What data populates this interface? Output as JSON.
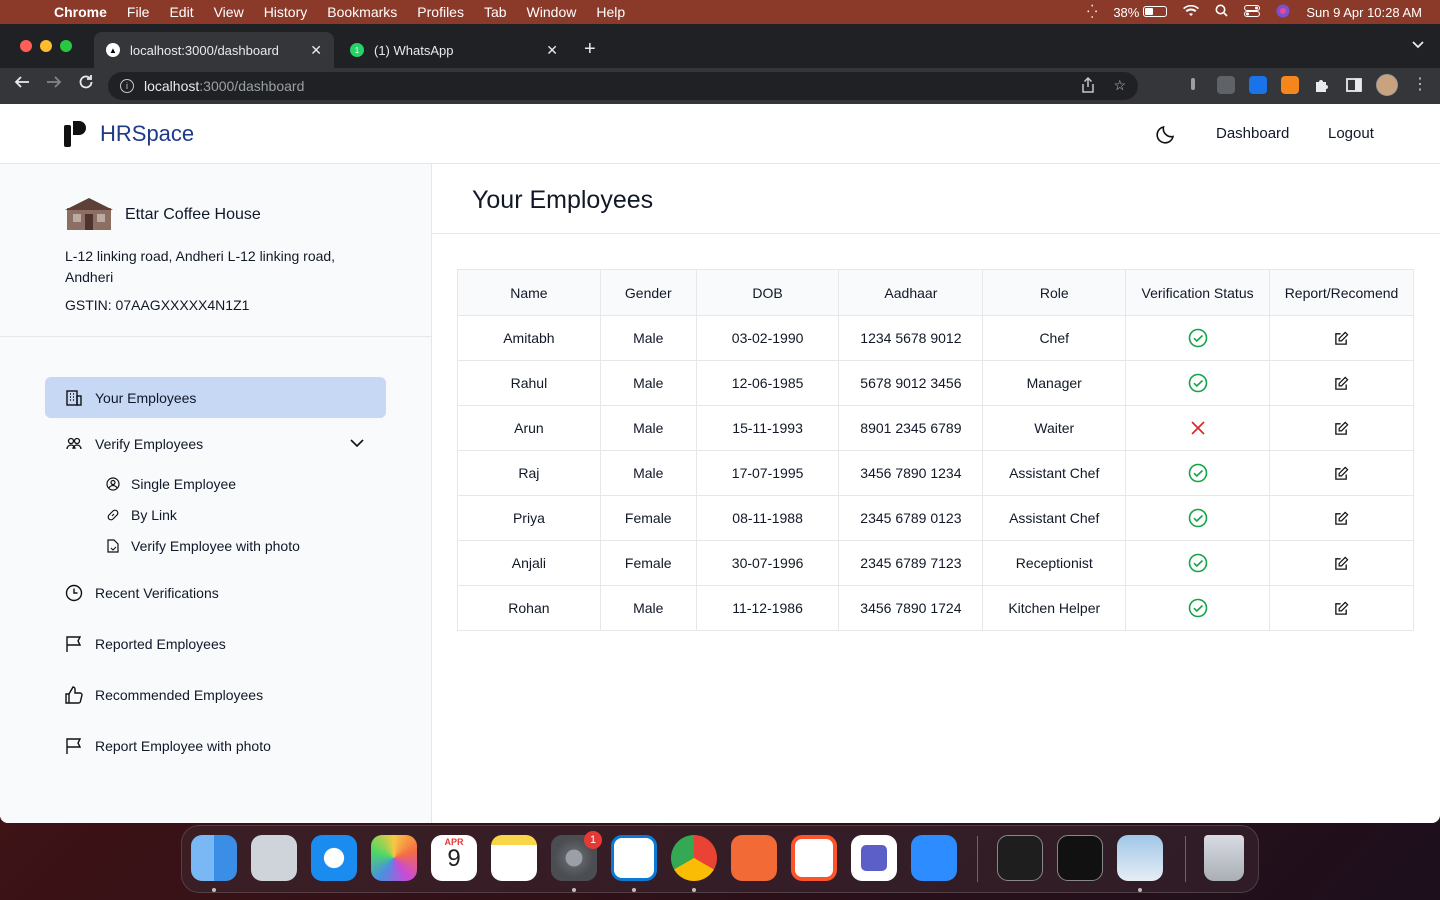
{
  "menubar": {
    "app": "Chrome",
    "items": [
      "File",
      "Edit",
      "View",
      "History",
      "Bookmarks",
      "Profiles",
      "Tab",
      "Window",
      "Help"
    ],
    "battery": "38%",
    "datetime": "Sun 9 Apr  10:28 AM"
  },
  "browser": {
    "tabs": [
      {
        "title": "localhost:3000/dashboard",
        "active": true
      },
      {
        "title": "(1) WhatsApp",
        "active": false
      }
    ],
    "url_host": "localhost",
    "url_path": ":3000/dashboard"
  },
  "app": {
    "brand": "HRSpace",
    "nav": {
      "dashboard": "Dashboard",
      "logout": "Logout"
    },
    "business": {
      "name": "Ettar Coffee House",
      "address": "L-12 linking road, Andheri L-12 linking road, Andheri",
      "gstin": "GSTIN: 07AAGXXXXX4N1Z1"
    },
    "sidebar": {
      "your_employees": "Your Employees",
      "verify_employees": "Verify Employees",
      "single_employee": "Single Employee",
      "by_link": "By Link",
      "verify_with_photo": "Verify Employee with photo",
      "recent_verifications": "Recent Verifications",
      "reported_employees": "Reported Employees",
      "recommended_employees": "Recommended Employees",
      "report_with_photo": "Report Employee with photo"
    },
    "main": {
      "title": "Your Employees",
      "columns": [
        "Name",
        "Gender",
        "DOB",
        "Aadhaar",
        "Role",
        "Verification Status",
        "Report/Recomend"
      ],
      "rows": [
        {
          "name": "Amitabh",
          "gender": "Male",
          "dob": "03-02-1990",
          "aadhaar": "1234 5678 9012",
          "role": "Chef",
          "verified": true
        },
        {
          "name": "Rahul",
          "gender": "Male",
          "dob": "12-06-1985",
          "aadhaar": "5678 9012 3456",
          "role": "Manager",
          "verified": true
        },
        {
          "name": "Arun",
          "gender": "Male",
          "dob": "15-11-1993",
          "aadhaar": "8901 2345 6789",
          "role": "Waiter",
          "verified": false
        },
        {
          "name": "Raj",
          "gender": "Male",
          "dob": "17-07-1995",
          "aadhaar": "3456 7890 1234",
          "role": "Assistant Chef",
          "verified": true
        },
        {
          "name": "Priya",
          "gender": "Female",
          "dob": "08-11-1988",
          "aadhaar": "2345 6789 0123",
          "role": "Assistant Chef",
          "verified": true
        },
        {
          "name": "Anjali",
          "gender": "Female",
          "dob": "30-07-1996",
          "aadhaar": "2345 6789 7123",
          "role": "Receptionist",
          "verified": true
        },
        {
          "name": "Rohan",
          "gender": "Male",
          "dob": "11-12-1986",
          "aadhaar": "3456 7890 1724",
          "role": "Kitchen Helper",
          "verified": true
        }
      ]
    }
  },
  "dock": {
    "calendar_month": "APR",
    "calendar_day": "9",
    "settings_badge": "1",
    "apps": [
      "finder-icon",
      "launchpad-icon",
      "safari-icon",
      "photos-icon",
      "calendar-icon",
      "notes-icon",
      "system-settings-icon",
      "vscode-icon",
      "chrome-icon",
      "postman-icon",
      "brave-icon",
      "teams-icon",
      "zoom-icon",
      "terminal-icon",
      "activity-monitor-icon",
      "preview-icon",
      "trash-icon"
    ]
  },
  "colors": {
    "verified": "#16a34a",
    "not_verified": "#dc2626",
    "active_menu": "#c7d8f5",
    "brand": "#1e3a8a"
  }
}
